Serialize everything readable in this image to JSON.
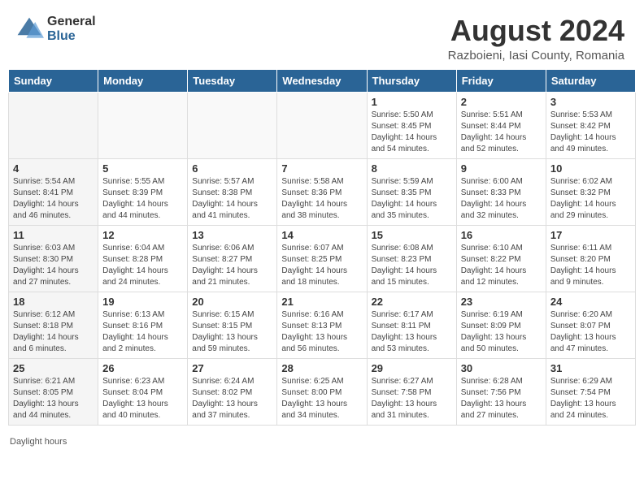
{
  "header": {
    "logo_general": "General",
    "logo_blue": "Blue",
    "title": "August 2024",
    "location": "Razboieni, Iasi County, Romania"
  },
  "days_of_week": [
    "Sunday",
    "Monday",
    "Tuesday",
    "Wednesday",
    "Thursday",
    "Friday",
    "Saturday"
  ],
  "weeks": [
    [
      {
        "day": "",
        "info": ""
      },
      {
        "day": "",
        "info": ""
      },
      {
        "day": "",
        "info": ""
      },
      {
        "day": "",
        "info": ""
      },
      {
        "day": "1",
        "info": "Sunrise: 5:50 AM\nSunset: 8:45 PM\nDaylight: 14 hours and 54 minutes."
      },
      {
        "day": "2",
        "info": "Sunrise: 5:51 AM\nSunset: 8:44 PM\nDaylight: 14 hours and 52 minutes."
      },
      {
        "day": "3",
        "info": "Sunrise: 5:53 AM\nSunset: 8:42 PM\nDaylight: 14 hours and 49 minutes."
      }
    ],
    [
      {
        "day": "4",
        "info": "Sunrise: 5:54 AM\nSunset: 8:41 PM\nDaylight: 14 hours and 46 minutes."
      },
      {
        "day": "5",
        "info": "Sunrise: 5:55 AM\nSunset: 8:39 PM\nDaylight: 14 hours and 44 minutes."
      },
      {
        "day": "6",
        "info": "Sunrise: 5:57 AM\nSunset: 8:38 PM\nDaylight: 14 hours and 41 minutes."
      },
      {
        "day": "7",
        "info": "Sunrise: 5:58 AM\nSunset: 8:36 PM\nDaylight: 14 hours and 38 minutes."
      },
      {
        "day": "8",
        "info": "Sunrise: 5:59 AM\nSunset: 8:35 PM\nDaylight: 14 hours and 35 minutes."
      },
      {
        "day": "9",
        "info": "Sunrise: 6:00 AM\nSunset: 8:33 PM\nDaylight: 14 hours and 32 minutes."
      },
      {
        "day": "10",
        "info": "Sunrise: 6:02 AM\nSunset: 8:32 PM\nDaylight: 14 hours and 29 minutes."
      }
    ],
    [
      {
        "day": "11",
        "info": "Sunrise: 6:03 AM\nSunset: 8:30 PM\nDaylight: 14 hours and 27 minutes."
      },
      {
        "day": "12",
        "info": "Sunrise: 6:04 AM\nSunset: 8:28 PM\nDaylight: 14 hours and 24 minutes."
      },
      {
        "day": "13",
        "info": "Sunrise: 6:06 AM\nSunset: 8:27 PM\nDaylight: 14 hours and 21 minutes."
      },
      {
        "day": "14",
        "info": "Sunrise: 6:07 AM\nSunset: 8:25 PM\nDaylight: 14 hours and 18 minutes."
      },
      {
        "day": "15",
        "info": "Sunrise: 6:08 AM\nSunset: 8:23 PM\nDaylight: 14 hours and 15 minutes."
      },
      {
        "day": "16",
        "info": "Sunrise: 6:10 AM\nSunset: 8:22 PM\nDaylight: 14 hours and 12 minutes."
      },
      {
        "day": "17",
        "info": "Sunrise: 6:11 AM\nSunset: 8:20 PM\nDaylight: 14 hours and 9 minutes."
      }
    ],
    [
      {
        "day": "18",
        "info": "Sunrise: 6:12 AM\nSunset: 8:18 PM\nDaylight: 14 hours and 6 minutes."
      },
      {
        "day": "19",
        "info": "Sunrise: 6:13 AM\nSunset: 8:16 PM\nDaylight: 14 hours and 2 minutes."
      },
      {
        "day": "20",
        "info": "Sunrise: 6:15 AM\nSunset: 8:15 PM\nDaylight: 13 hours and 59 minutes."
      },
      {
        "day": "21",
        "info": "Sunrise: 6:16 AM\nSunset: 8:13 PM\nDaylight: 13 hours and 56 minutes."
      },
      {
        "day": "22",
        "info": "Sunrise: 6:17 AM\nSunset: 8:11 PM\nDaylight: 13 hours and 53 minutes."
      },
      {
        "day": "23",
        "info": "Sunrise: 6:19 AM\nSunset: 8:09 PM\nDaylight: 13 hours and 50 minutes."
      },
      {
        "day": "24",
        "info": "Sunrise: 6:20 AM\nSunset: 8:07 PM\nDaylight: 13 hours and 47 minutes."
      }
    ],
    [
      {
        "day": "25",
        "info": "Sunrise: 6:21 AM\nSunset: 8:05 PM\nDaylight: 13 hours and 44 minutes."
      },
      {
        "day": "26",
        "info": "Sunrise: 6:23 AM\nSunset: 8:04 PM\nDaylight: 13 hours and 40 minutes."
      },
      {
        "day": "27",
        "info": "Sunrise: 6:24 AM\nSunset: 8:02 PM\nDaylight: 13 hours and 37 minutes."
      },
      {
        "day": "28",
        "info": "Sunrise: 6:25 AM\nSunset: 8:00 PM\nDaylight: 13 hours and 34 minutes."
      },
      {
        "day": "29",
        "info": "Sunrise: 6:27 AM\nSunset: 7:58 PM\nDaylight: 13 hours and 31 minutes."
      },
      {
        "day": "30",
        "info": "Sunrise: 6:28 AM\nSunset: 7:56 PM\nDaylight: 13 hours and 27 minutes."
      },
      {
        "day": "31",
        "info": "Sunrise: 6:29 AM\nSunset: 7:54 PM\nDaylight: 13 hours and 24 minutes."
      }
    ]
  ],
  "footnote": "Daylight hours"
}
